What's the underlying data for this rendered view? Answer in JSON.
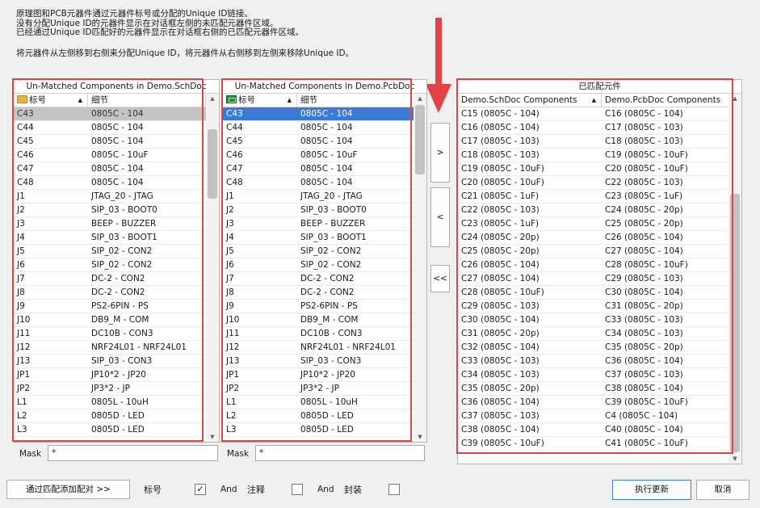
{
  "description": {
    "lines": [
      "原理图和PCB元器件通过元器件标号或分配的Unique ID链接。",
      "没有分配Unique ID的元器件显示在对话框左侧的未匹配元器件区域。",
      "已经通过Unique ID匹配好的元器件显示在对话框右侧的已匹配元器件区域。"
    ],
    "hint": "将元器件从左侧移到右侧来分配Unique ID，将元器件从右侧移到左侧来移除Unique ID。"
  },
  "left_panel": {
    "title": "Un-Matched Components in Demo.SchDoc",
    "col_designator": "标号",
    "col_detail": "细节",
    "rows": [
      [
        "C43",
        "0805C - 104"
      ],
      [
        "C44",
        "0805C - 104"
      ],
      [
        "C45",
        "0805C - 104"
      ],
      [
        "C46",
        "0805C - 10uF"
      ],
      [
        "C47",
        "0805C - 104"
      ],
      [
        "C48",
        "0805C - 104"
      ],
      [
        "J1",
        "JTAG_20 - JTAG"
      ],
      [
        "J2",
        "SIP_03 - BOOT0"
      ],
      [
        "J3",
        "BEEP - BUZZER"
      ],
      [
        "J4",
        "SIP_03 - BOOT1"
      ],
      [
        "J5",
        "SIP_02 - CON2"
      ],
      [
        "J6",
        "SIP_02 - CON2"
      ],
      [
        "J7",
        "DC-2 - CON2"
      ],
      [
        "J8",
        "DC-2 - CON2"
      ],
      [
        "J9",
        "PS2-6PIN - PS"
      ],
      [
        "J10",
        "DB9_M - COM"
      ],
      [
        "J11",
        "DC10B - CON3"
      ],
      [
        "J12",
        "NRF24L01 - NRF24L01"
      ],
      [
        "J13",
        "SIP_03 - CON3"
      ],
      [
        "JP1",
        "JP10*2 - JP20"
      ],
      [
        "JP2",
        "JP3*2 - JP"
      ],
      [
        "L1",
        "0805L - 10uH"
      ],
      [
        "L2",
        "0805D - LED"
      ],
      [
        "L3",
        "0805D - LED"
      ]
    ],
    "mask_label": "Mask",
    "mask_value": "*"
  },
  "middle_panel": {
    "title": "Un-Matched Components in Demo.PcbDoc",
    "col_designator": "标号",
    "col_detail": "细节",
    "rows": [
      [
        "C43",
        "0805C - 104"
      ],
      [
        "C44",
        "0805C - 104"
      ],
      [
        "C45",
        "0805C - 104"
      ],
      [
        "C46",
        "0805C - 10uF"
      ],
      [
        "C47",
        "0805C - 104"
      ],
      [
        "C48",
        "0805C - 104"
      ],
      [
        "J1",
        "JTAG_20 - JTAG"
      ],
      [
        "J2",
        "SIP_03 - BOOT0"
      ],
      [
        "J3",
        "BEEP - BUZZER"
      ],
      [
        "J4",
        "SIP_03 - BOOT1"
      ],
      [
        "J5",
        "SIP_02 - CON2"
      ],
      [
        "J6",
        "SIP_02 - CON2"
      ],
      [
        "J7",
        "DC-2 - CON2"
      ],
      [
        "J8",
        "DC-2 - CON2"
      ],
      [
        "J9",
        "PS2-6PIN - PS"
      ],
      [
        "J10",
        "DB9_M - COM"
      ],
      [
        "J11",
        "DC10B - CON3"
      ],
      [
        "J12",
        "NRF24L01 - NRF24L01"
      ],
      [
        "J13",
        "SIP_03 - CON3"
      ],
      [
        "JP1",
        "JP10*2 - JP20"
      ],
      [
        "JP2",
        "JP3*2 - JP"
      ],
      [
        "L1",
        "0805L - 10uH"
      ],
      [
        "L2",
        "0805D - LED"
      ],
      [
        "L3",
        "0805D - LED"
      ]
    ],
    "mask_label": "Mask",
    "mask_value": "*"
  },
  "right_panel": {
    "title": "已匹配元件",
    "col_sch": "Demo.SchDoc Components",
    "col_pcb": "Demo.PcbDoc Components",
    "rows": [
      [
        "C15 (0805C - 104)",
        "C16 (0805C - 104)"
      ],
      [
        "C16 (0805C - 104)",
        "C17 (0805C - 103)"
      ],
      [
        "C17 (0805C - 103)",
        "C18 (0805C - 103)"
      ],
      [
        "C18 (0805C - 103)",
        "C19 (0805C - 10uF)"
      ],
      [
        "C19 (0805C - 10uF)",
        "C20 (0805C - 10uF)"
      ],
      [
        "C20 (0805C - 10uF)",
        "C22 (0805C - 103)"
      ],
      [
        "C21 (0805C - 1uF)",
        "C23 (0805C - 1uF)"
      ],
      [
        "C22 (0805C - 103)",
        "C24 (0805C - 20p)"
      ],
      [
        "C23 (0805C - 1uF)",
        "C25 (0805C - 20p)"
      ],
      [
        "C24 (0805C - 20p)",
        "C26 (0805C - 104)"
      ],
      [
        "C25 (0805C - 20p)",
        "C27 (0805C - 104)"
      ],
      [
        "C26 (0805C - 104)",
        "C28 (0805C - 10uF)"
      ],
      [
        "C27 (0805C - 104)",
        "C29 (0805C - 103)"
      ],
      [
        "C28 (0805C - 10uF)",
        "C30 (0805C - 104)"
      ],
      [
        "C29 (0805C - 103)",
        "C31 (0805C - 20p)"
      ],
      [
        "C30 (0805C - 104)",
        "C33 (0805C - 103)"
      ],
      [
        "C31 (0805C - 20p)",
        "C34 (0805C - 103)"
      ],
      [
        "C32 (0805C - 104)",
        "C35 (0805C - 20p)"
      ],
      [
        "C33 (0805C - 103)",
        "C36 (0805C - 104)"
      ],
      [
        "C34 (0805C - 103)",
        "C37 (0805C - 103)"
      ],
      [
        "C35 (0805C - 20p)",
        "C38 (0805C - 104)"
      ],
      [
        "C36 (0805C - 104)",
        "C39 (0805C - 10uF)"
      ],
      [
        "C37 (0805C - 103)",
        "C4 (0805C - 104)"
      ],
      [
        "C38 (0805C - 104)",
        "C40 (0805C - 104)"
      ],
      [
        "C39 (0805C - 10uF)",
        "C41 (0805C - 10uF)"
      ]
    ]
  },
  "move_buttons": {
    "move_right": ">",
    "move_left": "<",
    "move_all_left": "<<"
  },
  "footer": {
    "add_pairs_button": "通过匹配添加配对 >>",
    "designator_label": "标号",
    "designator_checked": true,
    "and_1": "And",
    "comment_label": "注释",
    "comment_checked": false,
    "and_2": "And",
    "footprint_label": "封装",
    "footprint_checked": false,
    "execute_button": "执行更新",
    "cancel_button": "取消"
  },
  "colors": {
    "highlight_red": "#e04545",
    "selection_blue": "#3b7ad6",
    "selection_gray": "#c4c4c4"
  }
}
